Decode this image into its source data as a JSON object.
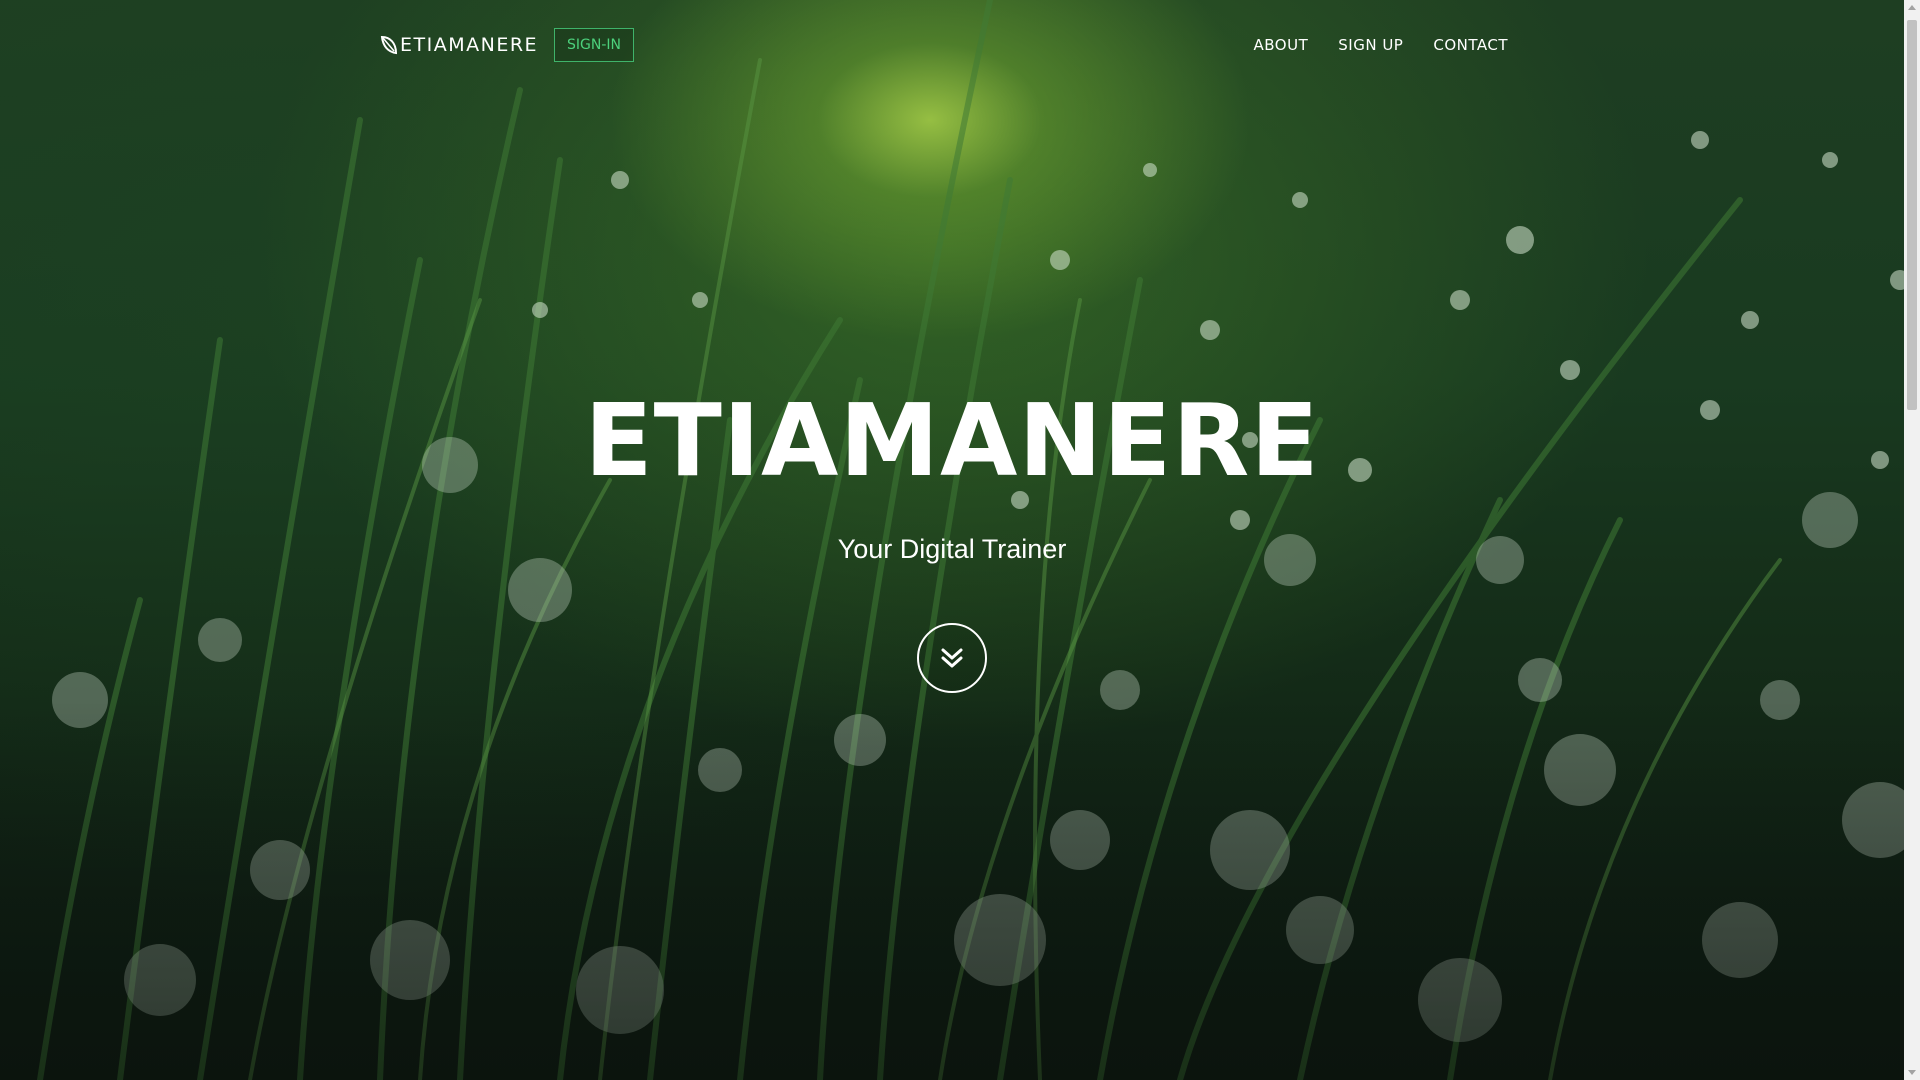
{
  "navbar": {
    "brand_name": "ETIAMANERE",
    "brand_icon": "leaf-icon",
    "signin_label": "SIGN-IN",
    "links": [
      {
        "label": "ABOUT"
      },
      {
        "label": "SIGN UP"
      },
      {
        "label": "CONTACT"
      }
    ]
  },
  "hero": {
    "title": "ETIAMANERE",
    "subtitle": "Your Digital Trainer",
    "scroll_icon": "chevron-double-down-icon"
  },
  "colors": {
    "accent_green": "#4cd17c",
    "button_border": "#3fb36a",
    "text": "#ffffff"
  }
}
